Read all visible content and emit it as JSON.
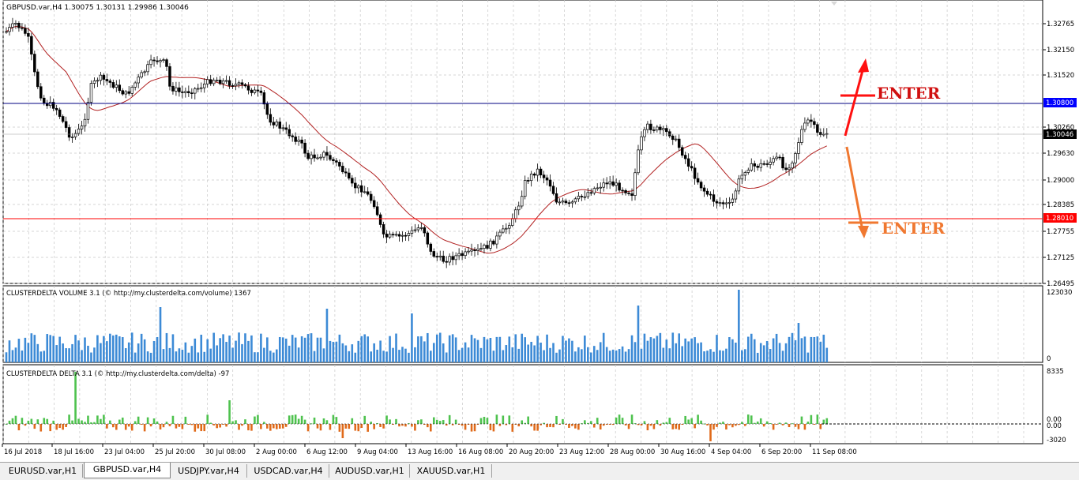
{
  "chart": {
    "symbol_header": "GBPUSD.var,H4  1.30075 1.30131 1.29986 1.30046",
    "price_axis": [
      "1.32765",
      "1.32150",
      "1.31520",
      "1.30260",
      "1.29630",
      "1.29000",
      "1.28385",
      "1.27755",
      "1.27125",
      "1.26495"
    ],
    "date_axis": [
      "16 Jul 2018",
      "18 Jul 16:00",
      "23 Jul 04:00",
      "25 Jul 20:00",
      "30 Jul 08:00",
      "2 Aug 00:00",
      "6 Aug 12:00",
      "9 Aug 04:00",
      "13 Aug 16:00",
      "16 Aug 08:00",
      "20 Aug 20:00",
      "23 Aug 12:00",
      "28 Aug 00:00",
      "30 Aug 16:00",
      "4 Sep 04:00",
      "6 Sep 20:00",
      "11 Sep 08:00"
    ],
    "resistance_label": "1.30800",
    "current_price_label": "1.30046",
    "support_label": "1.28010",
    "annotation_up": "ENTER",
    "annotation_down": "ENTER",
    "colors": {
      "resistance": "#000080",
      "support": "#ff0000",
      "arrow_up": "#ff0000",
      "arrow_down": "#f07830",
      "ma": "#b22222",
      "volume": "#3c8ad6",
      "delta_pos": "#4ec24e",
      "delta_neg": "#e06a1a"
    }
  },
  "volume_panel": {
    "title": "CLUSTERDELTA VOLUME 3.1 (© http://my.clusterdelta.com/volume) 1367",
    "axis_top": "123030",
    "axis_bottom": "0"
  },
  "delta_panel": {
    "title": "CLUSTERDELTA DELTA 3.1 (© http://my.clusterdelta.com/delta) -97",
    "axis_top": "8335",
    "axis_mid": "0.00",
    "axis_mid2": "0.00",
    "axis_bottom": "-3020"
  },
  "tabs": [
    "EURUSD.var,H1",
    "GBPUSD.var,H4",
    "USDJPY.var,H4",
    "USDCAD.var,H4",
    "AUDUSD.var,H1",
    "XAUUSD.var,H1"
  ],
  "active_tab": 1
}
